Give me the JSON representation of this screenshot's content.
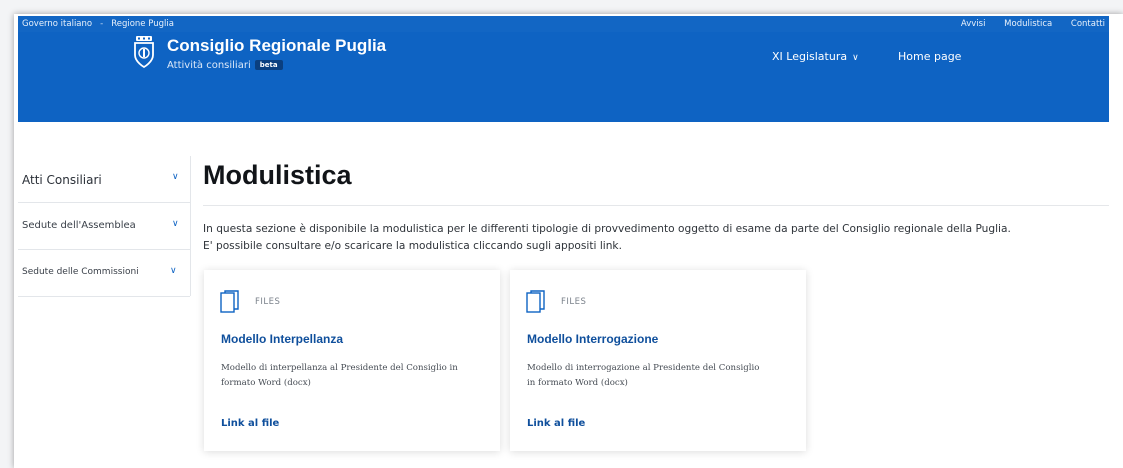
{
  "topbar": {
    "left_links": [
      "Governo italiano",
      "Regione Puglia"
    ],
    "separator": "-",
    "right_links": [
      "Avvisi",
      "Modulistica",
      "Contatti"
    ]
  },
  "header": {
    "title": "Consiglio Regionale Puglia",
    "subtitle": "Attività consiliari",
    "badge": "beta",
    "legislatura": "XI Legislatura",
    "home": "Home page"
  },
  "sidebar": {
    "items": [
      {
        "label": "Atti Consiliari",
        "icon": "chevron-down-icon"
      },
      {
        "label": "Sedute dell'Assemblea",
        "icon": "chevron-down-icon"
      },
      {
        "label": "Sedute delle Commissioni",
        "icon": "chevron-down-icon"
      }
    ]
  },
  "main": {
    "title": "Modulistica",
    "intro_line1": "In questa sezione è disponibile la modulistica per le differenti tipologie di provvedimento oggetto di esame da parte del Consiglio regionale della Puglia.",
    "intro_line2": "E' possibile consultare e/o scaricare la modulistica cliccando sugli appositi link."
  },
  "cards": [
    {
      "category": "FILES",
      "title": "Modello Interpellanza",
      "desc_line1": "Modello di interpellanza al Presidente del Consiglio in",
      "desc_line2": "formato Word (docx)",
      "link": "Link al file"
    },
    {
      "category": "FILES",
      "title": "Modello Interrogazione",
      "desc_line1": "Modello di interrogazione al Presidente del Consiglio",
      "desc_line2": "in formato Word (docx)",
      "link": "Link al file"
    }
  ],
  "colors": {
    "header_blue": "#0e63c3",
    "topbar_blue": "#1266c4",
    "link_blue": "#0f4f9c"
  }
}
